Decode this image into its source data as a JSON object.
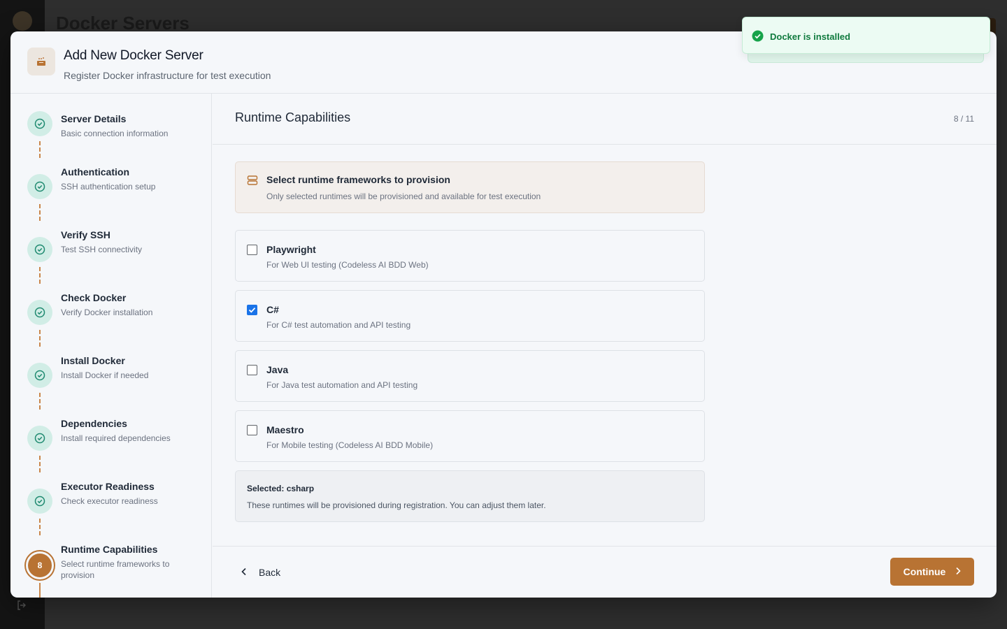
{
  "background": {
    "page_title": "Docker Servers"
  },
  "modal": {
    "title": "Add New Docker Server",
    "subtitle": "Register Docker infrastructure for test execution"
  },
  "steps": [
    {
      "title": "Server Details",
      "desc": "Basic connection information",
      "status": "done"
    },
    {
      "title": "Authentication",
      "desc": "SSH authentication setup",
      "status": "done"
    },
    {
      "title": "Verify SSH",
      "desc": "Test SSH connectivity",
      "status": "done"
    },
    {
      "title": "Check Docker",
      "desc": "Verify Docker installation",
      "status": "done"
    },
    {
      "title": "Install Docker",
      "desc": "Install Docker if needed",
      "status": "done"
    },
    {
      "title": "Dependencies",
      "desc": "Install required dependencies",
      "status": "done"
    },
    {
      "title": "Executor Readiness",
      "desc": "Check executor readiness",
      "status": "done"
    },
    {
      "title": "Runtime Capabilities",
      "desc": "Select runtime frameworks to provision",
      "status": "active",
      "number": "8"
    }
  ],
  "content": {
    "title": "Runtime Capabilities",
    "counter": "8 / 11",
    "info": {
      "title": "Select runtime frameworks to provision",
      "desc": "Only selected runtimes will be provisioned and available for test execution"
    },
    "options": [
      {
        "title": "Playwright",
        "desc": "For Web UI testing (Codeless AI BDD Web)",
        "checked": false
      },
      {
        "title": "C#",
        "desc": "For C# test automation and API testing",
        "checked": true
      },
      {
        "title": "Java",
        "desc": "For Java test automation and API testing",
        "checked": false
      },
      {
        "title": "Maestro",
        "desc": "For Mobile testing (Codeless AI BDD Mobile)",
        "checked": false
      }
    ],
    "summary": {
      "title": "Selected: csharp",
      "desc": "These runtimes will be provisioned during registration. You can adjust them later."
    },
    "footer": {
      "back_label": "Back",
      "continue_label": "Continue"
    }
  },
  "toast": {
    "message": "Docker is installed"
  },
  "colors": {
    "accent": "#b87333",
    "step_done_bg": "#d1ede6",
    "step_done_icon": "#1f8a70",
    "checkbox_checked": "#1a73e8",
    "toast_text": "#107a3e"
  },
  "icons": {
    "header": "docker-box-icon",
    "step_done": "check-circle-icon",
    "info": "server-stack-icon",
    "back": "chevron-left-icon",
    "continue": "chevron-right-icon",
    "toast": "check-circle-filled-icon"
  }
}
